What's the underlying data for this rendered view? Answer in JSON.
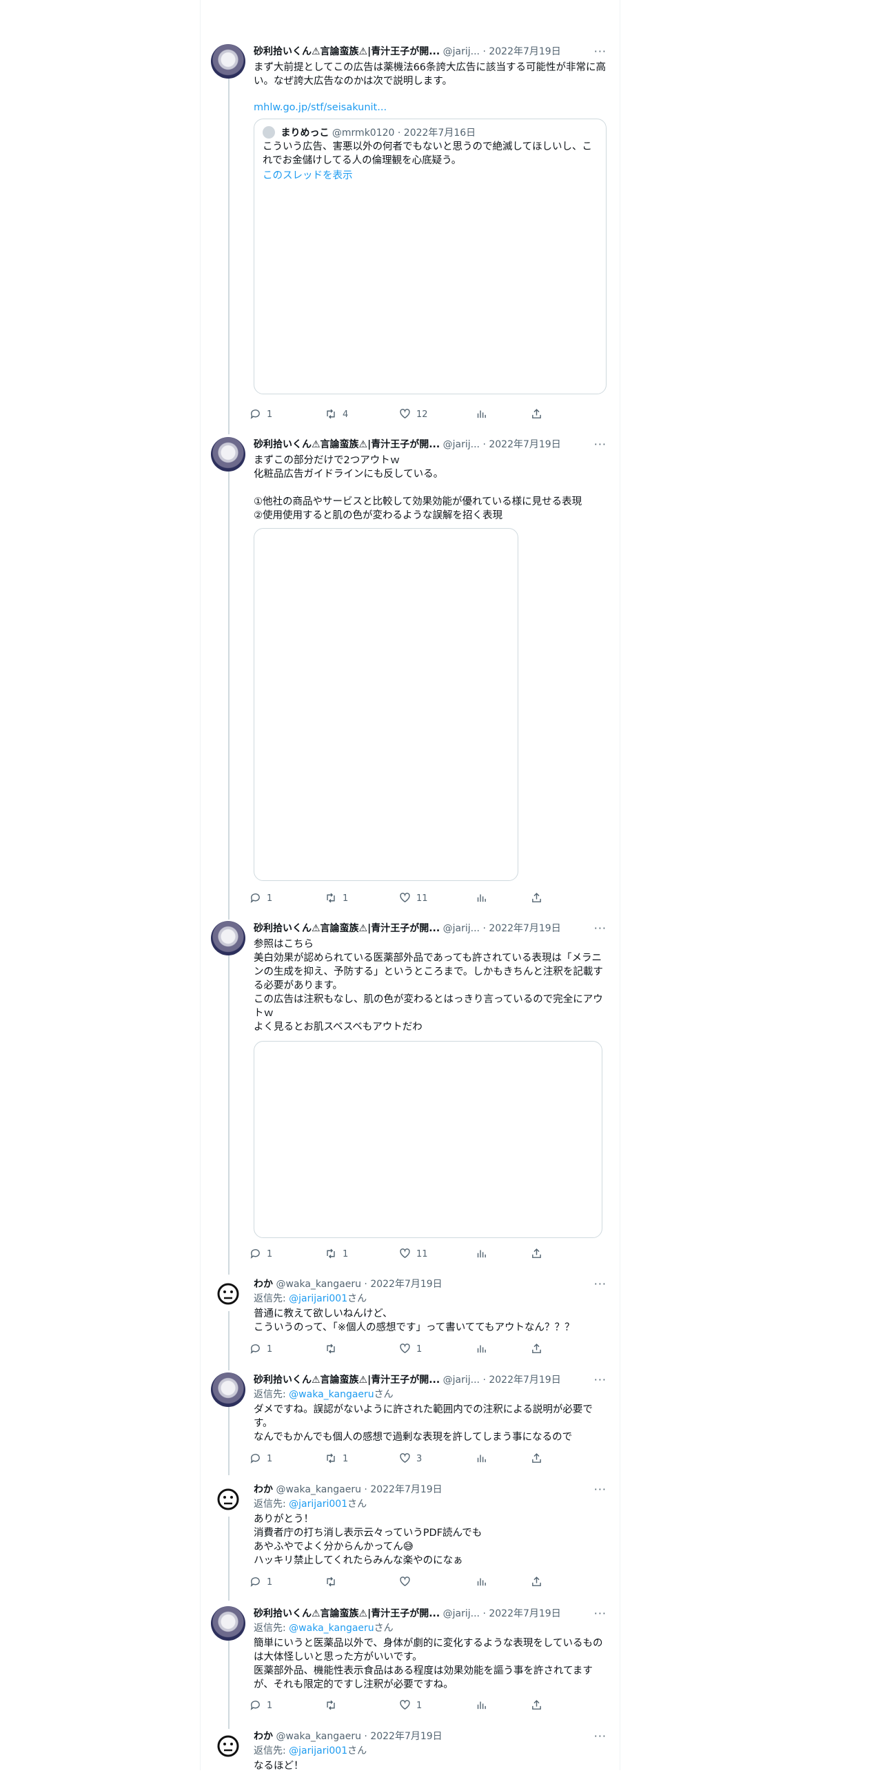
{
  "tweets": [
    {
      "name": "砂利拾いくん⚠言論蛮族⚠|青汁王子が開...",
      "handle": "@jarij...",
      "sep": "·",
      "date": "2022年7月19日",
      "text": "まず大前提としてこの広告は薬機法66条誇大広告に該当する可能性が非常に高い。なぜ誇大広告なのかは次で説明します。",
      "link": "mhlw.go.jp/stf/seisakunit...",
      "quote": {
        "name": "まりめっこ",
        "handle": "@mrmk0120",
        "sep": "·",
        "date": "2022年7月16日",
        "text": "こういう広告、害悪以外の何者でもないと思うので絶滅してほしいし、これでお金儲けしてる人の倫理観を心底疑う。",
        "show_thread": "このスレッドを表示"
      },
      "replies": "1",
      "retweets": "4",
      "likes": "12"
    },
    {
      "name": "砂利拾いくん⚠言論蛮族⚠|青汁王子が開...",
      "handle": "@jarij...",
      "sep": "·",
      "date": "2022年7月19日",
      "text": "まずこの部分だけで2つアウトｗ\n化粧品広告ガイドラインにも反している。\n\n①他社の商品やサービスと比較して効果効能が優れている様に見せる表現\n②使用使用すると肌の色が変わるような誤解を招く表現",
      "replies": "1",
      "retweets": "1",
      "likes": "11"
    },
    {
      "name": "砂利拾いくん⚠言論蛮族⚠|青汁王子が開...",
      "handle": "@jarij...",
      "sep": "·",
      "date": "2022年7月19日",
      "text": "参照はこちら\n美白効果が認められている医薬部外品であっても許されている表現は「メラニンの生成を抑え、予防する」というところまで。しかもきちんと注釈を記載する必要があります。\nこの広告は注釈もなし、肌の色が変わるとはっきり言っているので完全にアウトｗ\nよく見るとお肌スベスベもアウトだわ",
      "replies": "1",
      "retweets": "1",
      "likes": "11"
    },
    {
      "name": "わか",
      "handle": "@waka_kangaeru",
      "sep": "·",
      "date": "2022年7月19日",
      "reply_prefix": "返信先: ",
      "reply_to": "@jarijari001",
      "reply_suffix": "さん",
      "text": "普通に教えて欲しいねんけど、\nこういうのって、「※個人の感想です」って書いててもアウトなん？？？",
      "replies": "1",
      "retweets": "",
      "likes": "1"
    },
    {
      "name": "砂利拾いくん⚠言論蛮族⚠|青汁王子が開...",
      "handle": "@jarij...",
      "sep": "·",
      "date": "2022年7月19日",
      "reply_prefix": "返信先: ",
      "reply_to": "@waka_kangaeru",
      "reply_suffix": "さん",
      "text": "ダメですね。誤認がないように許された範囲内での注釈による説明が必要です。\nなんでもかんでも個人の感想で過剰な表現を許してしまう事になるので",
      "replies": "1",
      "retweets": "1",
      "likes": "3"
    },
    {
      "name": "わか",
      "handle": "@waka_kangaeru",
      "sep": "·",
      "date": "2022年7月19日",
      "reply_prefix": "返信先: ",
      "reply_to": "@jarijari001",
      "reply_suffix": "さん",
      "text": "ありがとう！\n消費者庁の打ち消し表示云々っていうPDF読んでも\nあやふやでよく分からんかってん😅\nハッキリ禁止してくれたらみんな楽やのになぁ",
      "replies": "1",
      "retweets": "",
      "likes": ""
    },
    {
      "name": "砂利拾いくん⚠言論蛮族⚠|青汁王子が開...",
      "handle": "@jarij...",
      "sep": "·",
      "date": "2022年7月19日",
      "reply_prefix": "返信先: ",
      "reply_to": "@waka_kangaeru",
      "reply_suffix": "さん",
      "text": "簡単にいうと医薬品以外で、身体が劇的に変化するような表現をしているものは大体怪しいと思った方がいいです。\n医薬部外品、機能性表示食品はある程度は効果効能を謳う事を許されてますが、それも限定的ですし注釈が必要ですね。",
      "replies": "1",
      "retweets": "",
      "likes": "1"
    },
    {
      "name": "わか",
      "handle": "@waka_kangaeru",
      "sep": "·",
      "date": "2022年7月19日",
      "reply_prefix": "返信先: ",
      "reply_to": "@jarijari001",
      "reply_suffix": "さん",
      "text": "なるほど！"
    }
  ],
  "more_label": "···",
  "icons": {
    "reply": "reply-icon",
    "retweet": "retweet-icon",
    "like": "like-icon",
    "views": "views-icon",
    "share": "share-icon",
    "more": "more-icon"
  },
  "colors": {
    "accent": "#1d9bf0",
    "muted": "#536471",
    "border": "#cfd9de"
  }
}
